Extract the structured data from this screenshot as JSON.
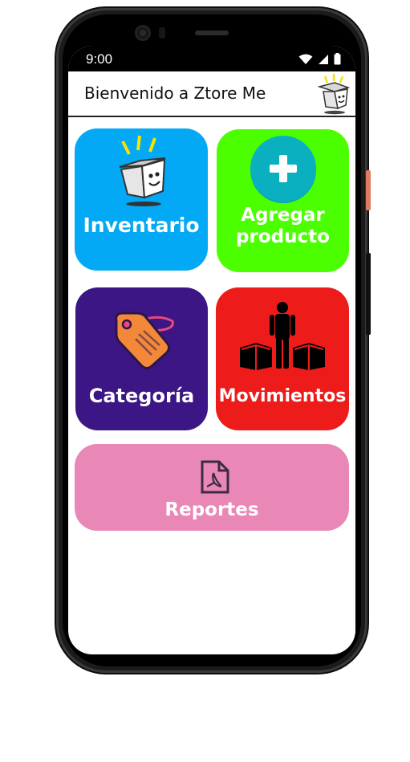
{
  "status_bar": {
    "time": "9:00"
  },
  "app_bar": {
    "title": "Bienvenido a Ztore Me"
  },
  "tiles": [
    {
      "label": "Inventario",
      "color": "#03a9f4",
      "icon": "box-icon"
    },
    {
      "label_line1": "Agregar",
      "label_line2": "producto",
      "color": "#4cff00",
      "icon": "plus-circle-icon"
    },
    {
      "label": "Categoría",
      "color": "#3c1684",
      "icon": "price-tag-icon"
    },
    {
      "label": "Movimientos",
      "color": "#ee1b1b",
      "icon": "person-boxes-icon"
    },
    {
      "label": "Reportes",
      "color": "#e987b7",
      "icon": "pdf-file-icon"
    }
  ]
}
